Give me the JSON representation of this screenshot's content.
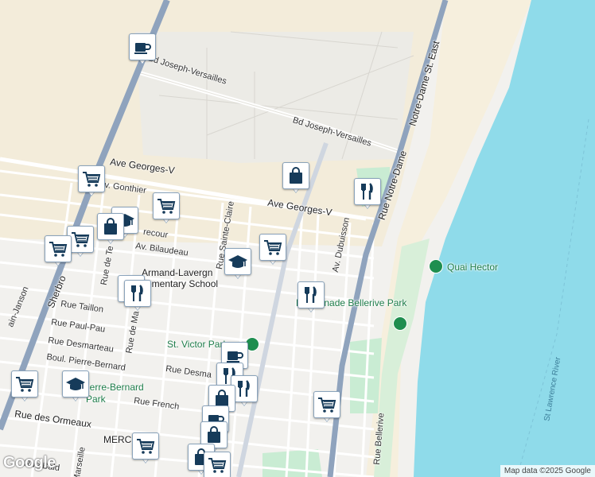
{
  "map": {
    "attribution": "Map data ©2025 Google",
    "logo": "Google",
    "colors": {
      "water": "#8fdbea",
      "land": "#f2f1ee",
      "sand": "#f3ecda",
      "park": "#c9ecd3",
      "arterial": "#8fa3bd",
      "pin_icon": "#163b5a",
      "poi_green": "#1e8e4f"
    }
  },
  "labels": {
    "bd_joseph_versailles_1": "Bd Joseph-Versailles",
    "bd_joseph_versailles_2": "Bd Joseph-Versailles",
    "ave_georges_v_1": "Ave Georges-V",
    "ave_georges_v_2": "Ave Georges-V",
    "av_gonthier": "Av. Gonthier",
    "rue_lecour": "recour",
    "av_bilaudeau": "Av. Bilaudeau",
    "rue_sainte_claire": "Rue Sainte-Claire",
    "rue_de_te": "Rue de Te",
    "rue_de_ma": "Rue de Ma",
    "armand_1": "Armand-Lavergn",
    "armand_2": "ementary School",
    "rue_taillon": "Rue Taillon",
    "rue_paul_pau": "Rue Paul-Pau",
    "rue_desmarteau": "Rue Desmarteau",
    "boul_pierre_bernard": "Boul. Pierre-Bernard",
    "rue_desma": "Rue Desma",
    "rue_french": "Rue French",
    "rue_des_ormeaux": "Rue des Ormeaux",
    "merc": "MERC",
    "rue_bald": "Rue Bald",
    "marseille": "Marseille",
    "sherbro": "Sherbro",
    "saint_janson": "ain-Janson",
    "av_dubuisson": "Av. Dubuisson",
    "rue_bellerive": "Rue Bellerive",
    "notre_dame": "Notre-Dame St. East",
    "rue_notre_dame": "Rue Notre-Dame",
    "quai_hector": "Quai Hector",
    "promenade_bellerive": "Promenade Bellerive Park",
    "st_victor_park": "St. Victor Park",
    "pierre_bernard_park_1": "Pierre-Bernard",
    "pierre_bernard_park_2": "Park",
    "st_lawrence_river": "St Lawrence River"
  },
  "markers": [
    {
      "icon": "coffee"
    },
    {
      "icon": "shopping-bag"
    },
    {
      "icon": "restaurant"
    },
    {
      "icon": "grocery"
    },
    {
      "icon": "grocery"
    },
    {
      "icon": "school"
    },
    {
      "icon": "shopping-bag"
    },
    {
      "icon": "grocery"
    },
    {
      "icon": "grocery"
    },
    {
      "icon": "grocery"
    },
    {
      "icon": "school"
    },
    {
      "icon": "restaurant"
    },
    {
      "icon": "restaurant"
    },
    {
      "icon": "restaurant"
    },
    {
      "icon": "coffee"
    },
    {
      "icon": "restaurant"
    },
    {
      "icon": "restaurant"
    },
    {
      "icon": "grocery"
    },
    {
      "icon": "school"
    },
    {
      "icon": "shopping-bag"
    },
    {
      "icon": "coffee"
    },
    {
      "icon": "grocery"
    },
    {
      "icon": "shopping-bag"
    },
    {
      "icon": "grocery"
    },
    {
      "icon": "shopping-bag"
    },
    {
      "icon": "grocery"
    }
  ]
}
